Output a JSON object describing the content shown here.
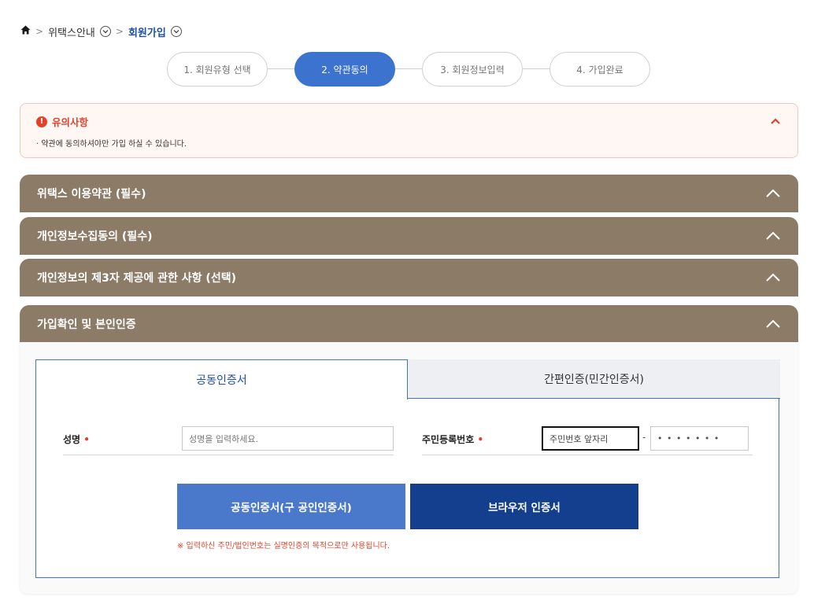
{
  "breadcrumb": {
    "section": "위택스안내",
    "current": "회원가입"
  },
  "steps": [
    "1. 회원유형 선택",
    "2. 약관동의",
    "3. 회원정보입력",
    "4. 가입완료"
  ],
  "active_step": 2,
  "notice": {
    "title": "유의사항",
    "text": "· 약관에 동의하셔야만 가입 하실 수 있습니다."
  },
  "accordions": [
    "위택스 이용약관 (필수)",
    "개인정보수집동의 (필수)",
    "개인정보의 제3자 제공에 관한 사항 (선택)",
    "가입확인 및 본인인증"
  ],
  "tabs": {
    "active": "공동인증서",
    "other": "간편인증(민간인증서)"
  },
  "form": {
    "name_label": "성명",
    "name_placeholder": "성명을 입력하세요.",
    "rrn_label": "주민등록번호",
    "rrn_front_placeholder": "주민번호 앞자리",
    "rrn_dash": "-",
    "rrn_back_mask": "• • • • • • •",
    "required_mark": "•"
  },
  "buttons": {
    "joint_cert": "공동인증서(구 공인인증서)",
    "browser_cert": "브라우저 인증서"
  },
  "footnote": "※ 입력하신 주민/법인번호는 실명인증의 목적으로만 사용됩니다.",
  "colors": {
    "accent": "#3b73cf",
    "accordion": "#8c7b67",
    "dark_button": "#143f8f",
    "warning": "#e4412b"
  }
}
